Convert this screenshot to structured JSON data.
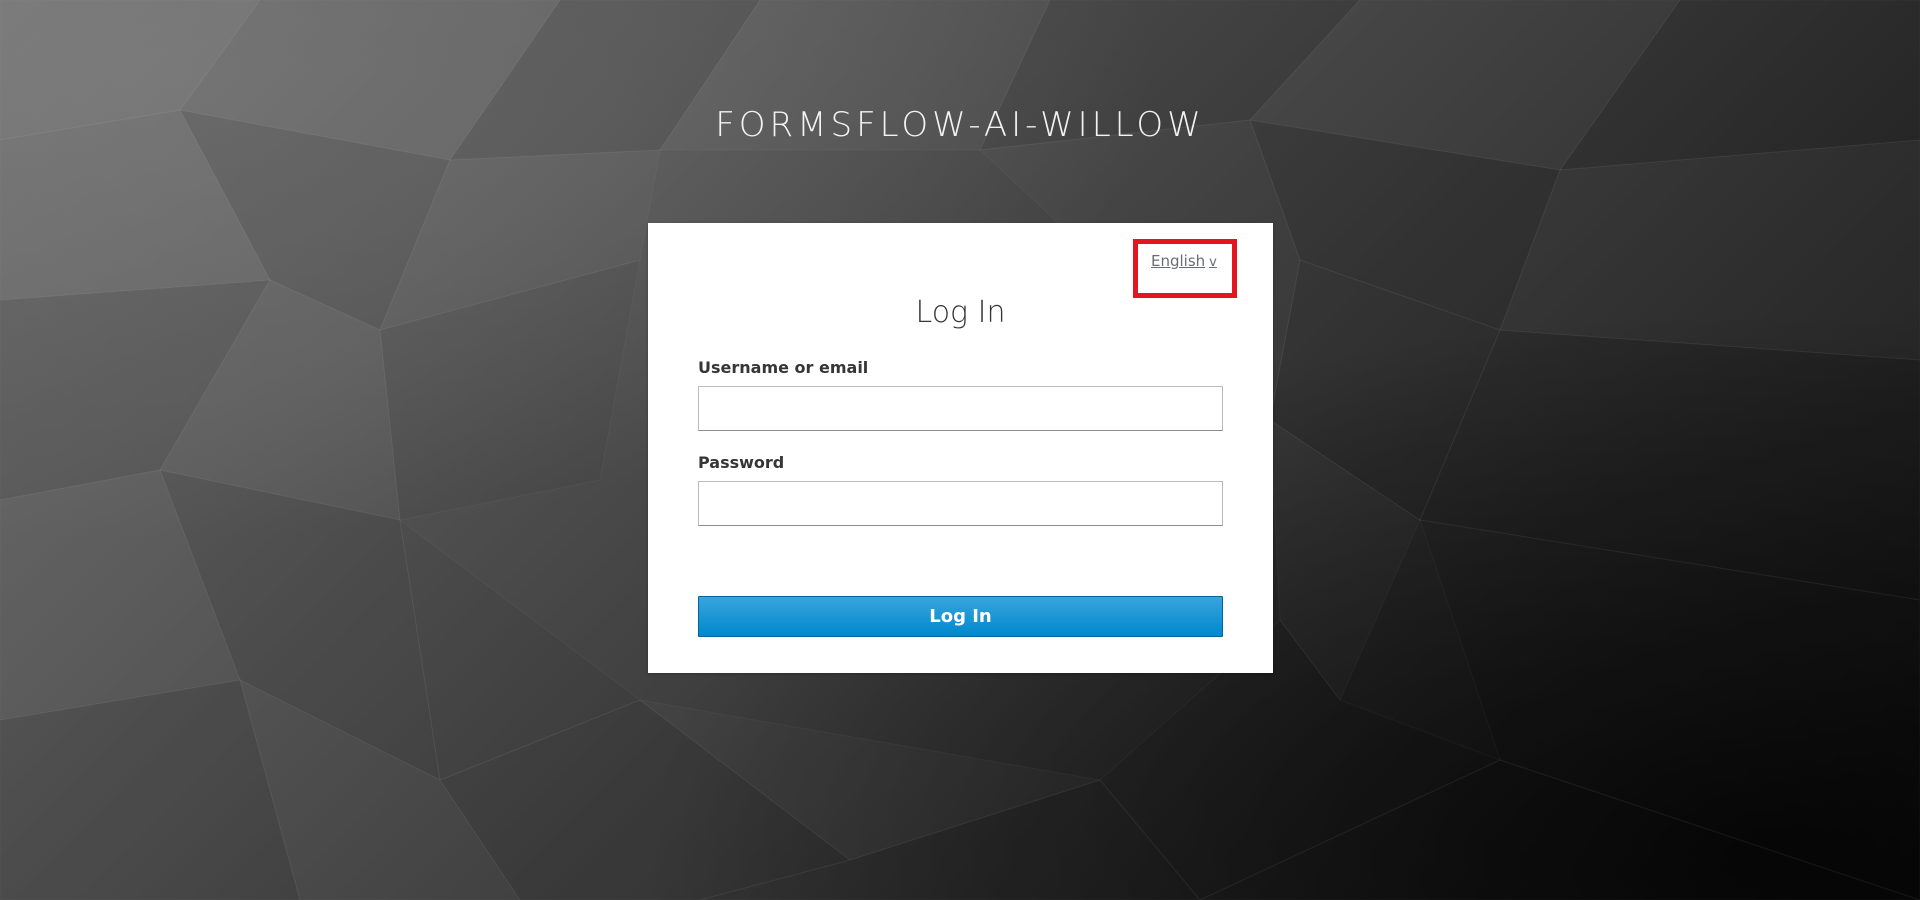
{
  "realm": {
    "title": "FORMSFLOW-AI-WILLOW"
  },
  "login": {
    "heading": "Log In",
    "language": {
      "selected": "English",
      "caret": "v",
      "highlight_color": "#e3161e"
    },
    "username": {
      "label": "Username or email",
      "value": "",
      "placeholder": ""
    },
    "password": {
      "label": "Password",
      "value": "",
      "placeholder": ""
    },
    "submit": {
      "label": "Log In",
      "color": "#0088ce"
    }
  }
}
